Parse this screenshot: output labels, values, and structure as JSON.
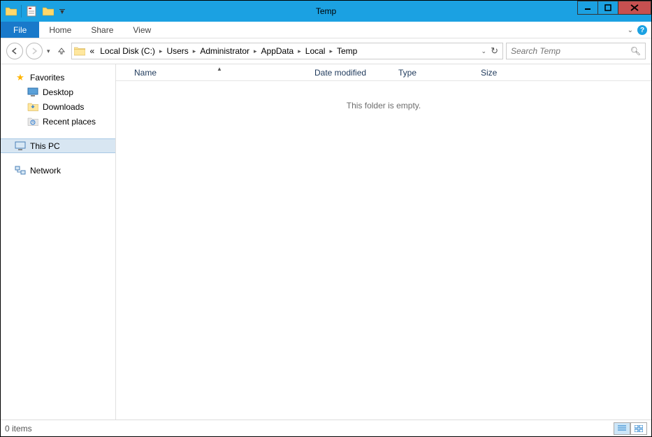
{
  "window": {
    "title": "Temp"
  },
  "ribbon": {
    "file": "File",
    "tabs": [
      "Home",
      "Share",
      "View"
    ]
  },
  "breadcrumb": {
    "overflow": "«",
    "items": [
      "Local Disk (C:)",
      "Users",
      "Administrator",
      "AppData",
      "Local",
      "Temp"
    ]
  },
  "search": {
    "placeholder": "Search Temp"
  },
  "nav_pane": {
    "favorites": {
      "label": "Favorites",
      "items": [
        {
          "icon": "desktop",
          "label": "Desktop"
        },
        {
          "icon": "downloads",
          "label": "Downloads"
        },
        {
          "icon": "recent",
          "label": "Recent places"
        }
      ]
    },
    "this_pc": {
      "label": "This PC"
    },
    "network": {
      "label": "Network"
    }
  },
  "columns": {
    "name": "Name",
    "date": "Date modified",
    "type": "Type",
    "size": "Size"
  },
  "content": {
    "empty_message": "This folder is empty."
  },
  "status": {
    "item_count": "0 items"
  }
}
